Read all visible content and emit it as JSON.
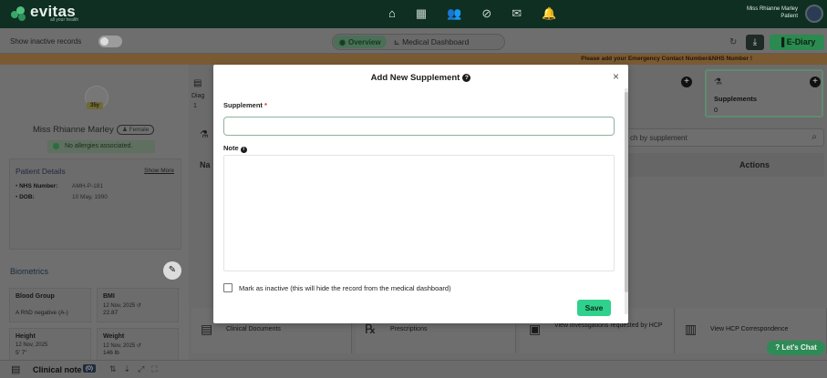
{
  "brand": {
    "name": "evitas",
    "tagline": "all your health"
  },
  "user": {
    "name": "Miss Rhianne Marley",
    "role": "Patient"
  },
  "nav": {
    "icons": [
      "home-icon",
      "calendar-icon",
      "people-icon",
      "link-icon",
      "mail-icon",
      "bell-icon"
    ]
  },
  "subbar": {
    "toggle_label": "Show inactive records",
    "tab_overview": "Overview",
    "tab_dashboard": "Medical Dashboard",
    "ediary_label": "E-Diary"
  },
  "banner": {
    "text": "Please add your Emergency Contact Number&NHS Number !"
  },
  "patient": {
    "age": "35y",
    "name": "Miss Rhianne Marley",
    "gender": "Female",
    "allergy": "No allergies associated.",
    "details_title": "Patient Details",
    "show_more": "Show More",
    "nhs_label": "NHS Number:",
    "nhs_value": "AMH-P-181",
    "dob_label": "DOB:",
    "dob_value": "10 May, 1990"
  },
  "biometrics": {
    "title": "Biometrics",
    "blood_group": {
      "title": "Blood Group",
      "value": "A RhD negative (A-)"
    },
    "bmi": {
      "title": "BMI",
      "date": "12 Nov, 2025",
      "value": "22.87"
    },
    "height": {
      "title": "Height",
      "date": "12 Nov, 2025",
      "value": "5' 7\""
    },
    "weight": {
      "title": "Weight",
      "date": "12 Nov, 2025",
      "value": "146 lb"
    }
  },
  "behind": {
    "diag_label": "Diag",
    "diag_count": "1",
    "supplements_label": "Supplements",
    "supplements_count": "0",
    "search_placeholder": "ch by supplement",
    "table_left_header": "Na",
    "actions_header": "Actions"
  },
  "bottom_cards": [
    {
      "label": "Clinical Documents"
    },
    {
      "label": "Prescriptions"
    },
    {
      "label": "View investigations requested by HCP"
    },
    {
      "label": "View HCP Correspondence"
    }
  ],
  "clinical_note": {
    "label": "Clinical note",
    "count": "(0)"
  },
  "chat": {
    "label": "Let's Chat"
  },
  "modal": {
    "title": "Add New Supplement",
    "supplement_label": "Supplement",
    "required_mark": "*",
    "supplement_value": "",
    "note_label": "Note",
    "note_value": "",
    "inactive_label": "Mark as inactive (this will hide the record from the medical dashboard)",
    "save_label": "Save"
  }
}
